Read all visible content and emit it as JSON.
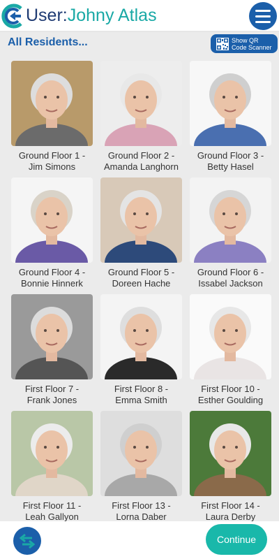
{
  "header": {
    "user_prefix": "User:",
    "user_name": "Johny Atlas",
    "logo_icon": "c-logo-icon",
    "menu_icon": "hamburger-menu-icon"
  },
  "subheader": {
    "title": "All Residents...",
    "qr_button": {
      "line1": "Show QR",
      "line2": "Code Scanner",
      "icon": "qr-code-icon"
    }
  },
  "residents": [
    {
      "floor": "Ground Floor 1 -",
      "name": "Jim Simons",
      "bg": "#b89a6a",
      "shirt": "#6b6b6b",
      "hair": "#ddd"
    },
    {
      "floor": "Ground Floor 2 -",
      "name": "Amanda Langhorn",
      "bg": "#ededed",
      "shirt": "#d9a3b6",
      "hair": "#e8e8e8"
    },
    {
      "floor": "Ground Floor 3 -",
      "name": "Betty Hasel",
      "bg": "#f7f7f7",
      "shirt": "#4a6fb0",
      "hair": "#cfcfcf"
    },
    {
      "floor": "Ground Floor 4 -",
      "name": "Bonnie Hinnerk",
      "bg": "#f5f5f5",
      "shirt": "#6a5aa6",
      "hair": "#d9d3c8"
    },
    {
      "floor": "Ground Floor 5 -",
      "name": "Doreen Hache",
      "bg": "#d8c9b8",
      "shirt": "#2d4a7a",
      "hair": "#e4e4e4"
    },
    {
      "floor": "Ground Floor 6 -",
      "name": "Issabel Jackson",
      "bg": "#f3f3f3",
      "shirt": "#8b80c2",
      "hair": "#d6d6d6"
    },
    {
      "floor": "First Floor 7 -",
      "name": "Frank Jones",
      "bg": "#9a9a9a",
      "shirt": "#555555",
      "hair": "#dcdcdc"
    },
    {
      "floor": "First Floor 8 -",
      "name": "Emma Smith",
      "bg": "#f4f4f4",
      "shirt": "#2a2a2a",
      "hair": "#dedede"
    },
    {
      "floor": "First Floor 10 -",
      "name": "Esther Goulding",
      "bg": "#fafafa",
      "shirt": "#e9e4e4",
      "hair": "#e7e7e7"
    },
    {
      "floor": "First Floor 11 -",
      "name": "Leah Gallyon",
      "bg": "#b9c7a7",
      "shirt": "#e0d6c8",
      "hair": "#ececec"
    },
    {
      "floor": "First Floor 13 -",
      "name": "Lorna Daber",
      "bg": "#dedede",
      "shirt": "#a8a8a8",
      "hair": "#cfcfcf"
    },
    {
      "floor": "First Floor 14 -",
      "name": "Laura Derby",
      "bg": "#4c7a3a",
      "shirt": "#8a6a4a",
      "hair": "#e8e8e8"
    }
  ],
  "footer": {
    "swap_icon": "swap-arrows-icon",
    "continue_label": "Continue"
  },
  "colors": {
    "primary_blue": "#1b5faa",
    "teal": "#19b8aa",
    "user_name_teal": "#1aa9a6",
    "grid_background": "#ebebeb"
  }
}
